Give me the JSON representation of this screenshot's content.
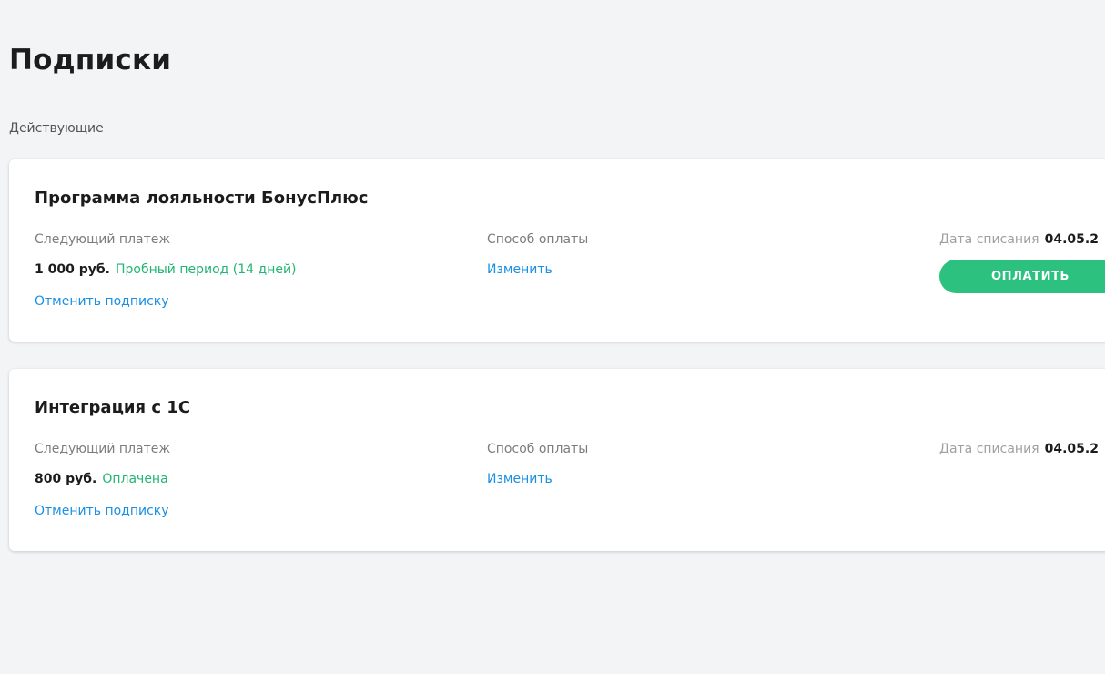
{
  "page": {
    "title": "Подписки",
    "section_label": "Действующие"
  },
  "subscriptions": [
    {
      "title": "Программа лояльности БонусПлюс",
      "next_payment_label": "Следующий платеж",
      "amount": "1 000 руб.",
      "status": "Пробный период (14 дней)",
      "cancel_label": "Отменить подписку",
      "payment_method_label": "Способ оплаты",
      "change_label": "Изменить",
      "charge_date_label": "Дата списания",
      "charge_date": "04.05.2",
      "pay_button_label": "ОПЛАТИТЬ"
    },
    {
      "title": "Интеграция с 1С",
      "next_payment_label": "Следующий платеж",
      "amount": "800 руб.",
      "status": "Оплачена",
      "cancel_label": "Отменить подписку",
      "payment_method_label": "Способ оплаты",
      "change_label": "Изменить",
      "charge_date_label": "Дата списания",
      "charge_date": "04.05.2"
    }
  ],
  "colors": {
    "accent_green": "#2cc17f",
    "status_green": "#22b573",
    "link_blue": "#1a8fe3",
    "background": "#f3f4f6"
  }
}
